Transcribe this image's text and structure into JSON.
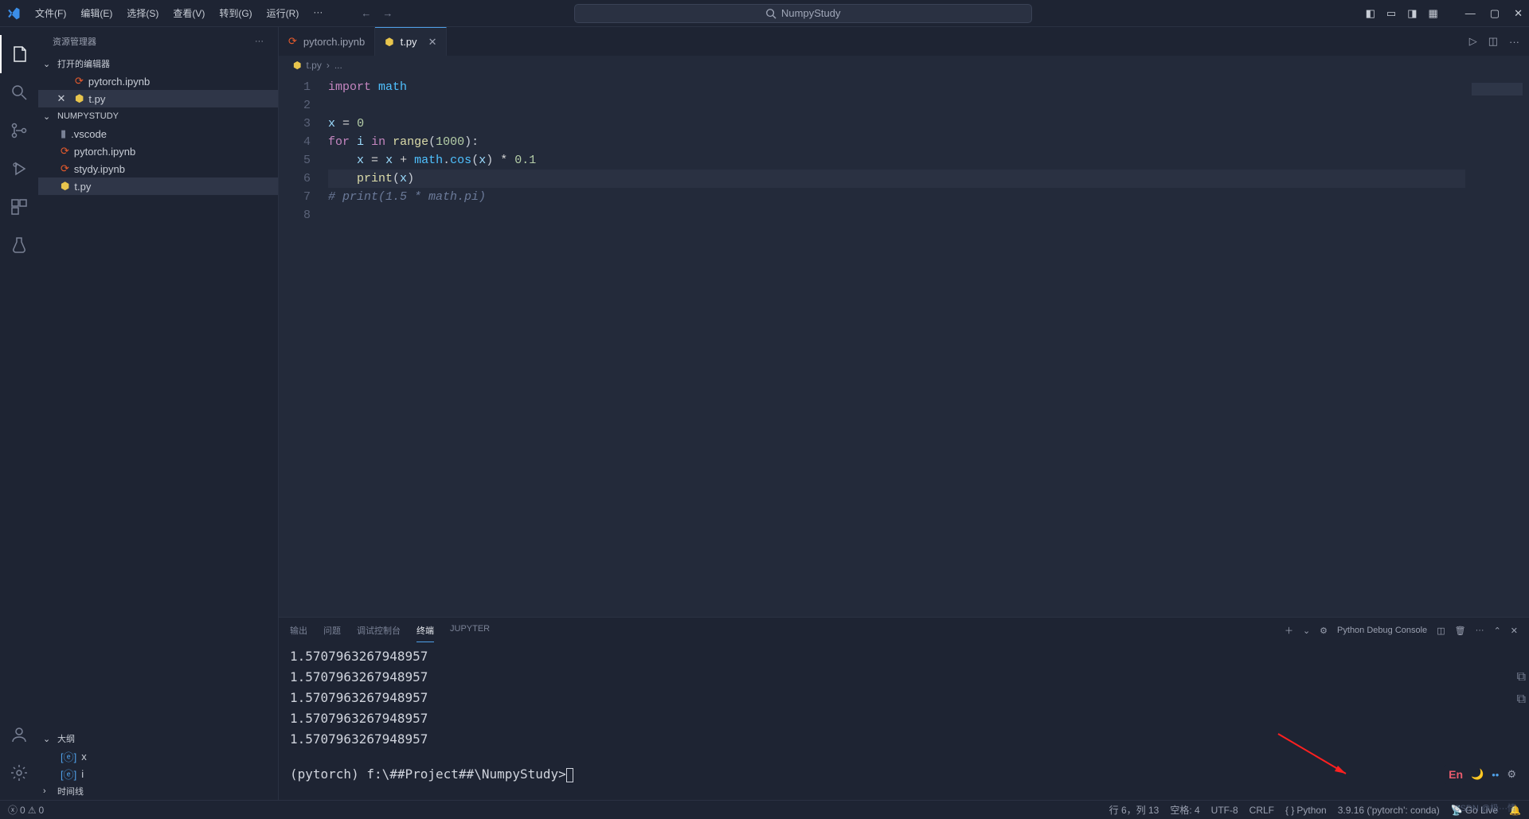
{
  "menu": [
    "文件(F)",
    "编辑(E)",
    "选择(S)",
    "查看(V)",
    "转到(G)",
    "运行(R)",
    "···"
  ],
  "search_text": "NumpyStudy",
  "sidebar": {
    "title": "资源管理器",
    "open_editors_header": "打开的编辑器",
    "open_editors": [
      {
        "name": "pytorch.ipynb",
        "icon": "jupyter",
        "closable": false
      },
      {
        "name": "t.py",
        "icon": "python",
        "closable": true,
        "active": true
      }
    ],
    "workspace_header": "NUMPYSTUDY",
    "workspace_items": [
      {
        "name": ".vscode",
        "icon": "folder"
      },
      {
        "name": "pytorch.ipynb",
        "icon": "jupyter"
      },
      {
        "name": "stydy.ipynb",
        "icon": "jupyter"
      },
      {
        "name": "t.py",
        "icon": "python",
        "active": true
      }
    ],
    "outline_header": "大纲",
    "outline_items": [
      {
        "name": "x",
        "icon": "var"
      },
      {
        "name": "i",
        "icon": "var"
      }
    ],
    "timeline_header": "时间线"
  },
  "tabs": [
    {
      "name": "pytorch.ipynb",
      "icon": "jupyter",
      "active": false
    },
    {
      "name": "t.py",
      "icon": "python",
      "active": true
    }
  ],
  "breadcrumb": [
    "t.py",
    "..."
  ],
  "code": {
    "lines": [
      {
        "n": 1,
        "html": "<span class='kw'>import</span> <span class='mod'>math</span>"
      },
      {
        "n": 2,
        "html": ""
      },
      {
        "n": 3,
        "html": "<span class='var'>x</span> <span class='op'>=</span> <span class='num'>0</span>"
      },
      {
        "n": 4,
        "html": "<span class='kw'>for</span> <span class='var'>i</span> <span class='kw'>in</span> <span class='builtin'>range</span>(<span class='num'>1000</span>):"
      },
      {
        "n": 5,
        "html": "    <span class='var'>x</span> <span class='op'>=</span> <span class='var'>x</span> <span class='op'>+</span> <span class='mod'>math</span>.<span class='fn'>cos</span>(<span class='var'>x</span>) <span class='op'>*</span> <span class='num'>0.1</span>"
      },
      {
        "n": 6,
        "html": "    <span class='builtin'>print</span>(<span class='var'>x</span>)",
        "current": true
      },
      {
        "n": 7,
        "html": "<span class='comment'># print(1.5 * math.pi)</span>"
      },
      {
        "n": 8,
        "html": ""
      }
    ]
  },
  "panel": {
    "tabs": [
      "输出",
      "问题",
      "调试控制台",
      "终端",
      "JUPYTER"
    ],
    "active_tab": 3,
    "terminal_label": "Python Debug Console",
    "output": [
      "1.5707963267948957",
      "1.5707963267948957",
      "1.5707963267948957",
      "1.5707963267948957",
      "1.5707963267948957"
    ],
    "prompt": "(pytorch) f:\\##Project##\\NumpyStudy>"
  },
  "status": {
    "errors": "0",
    "warnings": "0",
    "cursor": "行 6，列 13",
    "spaces": "空格: 4",
    "encoding": "UTF-8",
    "eol": "CRLF",
    "lang": "Python",
    "interp": "3.9.16 ('pytorch': conda)",
    "golive": "Go Live"
  },
  "float": {
    "lang": "En"
  },
  "watermark": "CSDN @极···情"
}
